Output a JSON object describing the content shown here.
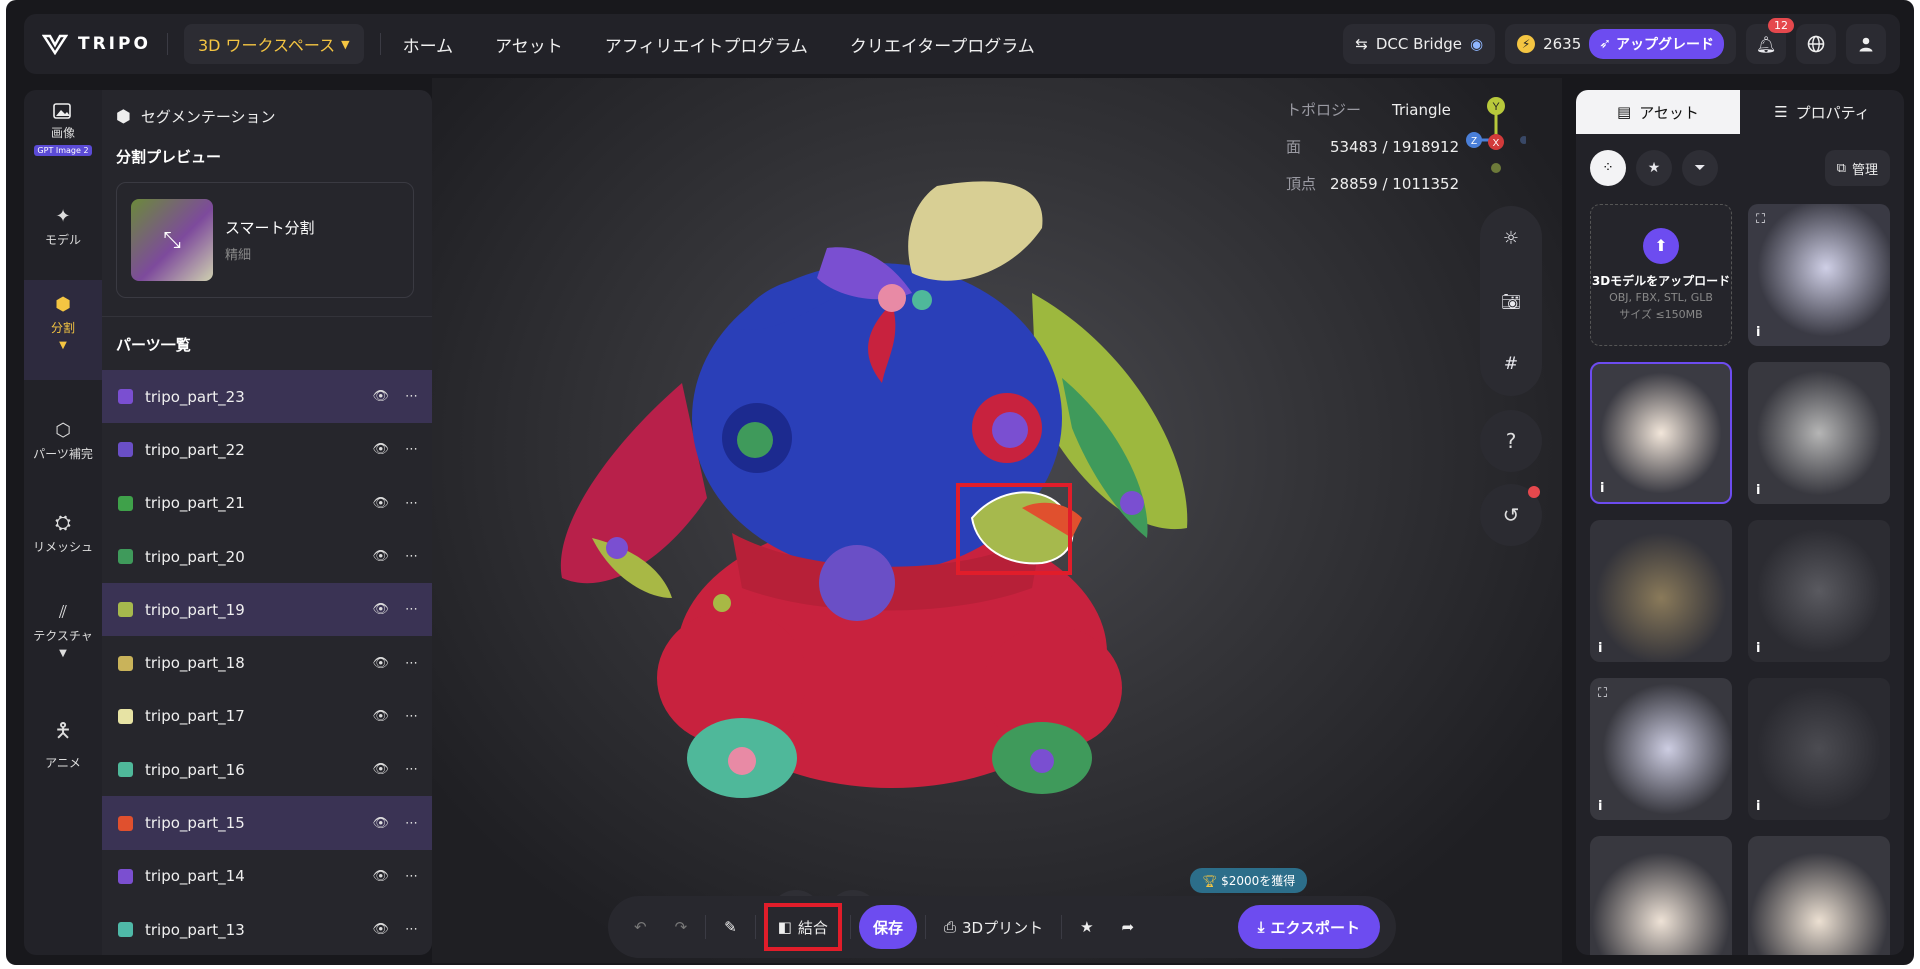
{
  "topbar": {
    "brand": "TRIPO",
    "workspace": "3D ワークスペース",
    "nav": [
      "ホーム",
      "アセット",
      "アフィリエイトプログラム",
      "クリエイタープログラム"
    ],
    "dcc": "DCC Bridge",
    "credits": "2635",
    "upgrade": "アップグレード",
    "notifications": "12"
  },
  "rail": {
    "image": "画像",
    "gpt_tag": "GPT Image 2",
    "model": "モデル",
    "split": "分割",
    "parts_complete": "パーツ補完",
    "remesh": "リメッシュ",
    "texture": "テクスチャ",
    "anime": "アニメ"
  },
  "panel": {
    "header": "セグメンテーション",
    "preview_title": "分割プレビュー",
    "smart_title": "スマート分割",
    "smart_sub": "精細",
    "parts_title": "パーツ一覧",
    "parts": [
      {
        "name": "tripo_part_23",
        "color": "#7a4fd1",
        "highlight": true
      },
      {
        "name": "tripo_part_22",
        "color": "#6a4fc6",
        "highlight": false
      },
      {
        "name": "tripo_part_21",
        "color": "#3fa14a",
        "highlight": false
      },
      {
        "name": "tripo_part_20",
        "color": "#3f9a5b",
        "highlight": false
      },
      {
        "name": "tripo_part_19",
        "color": "#a6b94d",
        "highlight": true
      },
      {
        "name": "tripo_part_18",
        "color": "#c9b35a",
        "highlight": false
      },
      {
        "name": "tripo_part_17",
        "color": "#e7e3a4",
        "highlight": false
      },
      {
        "name": "tripo_part_16",
        "color": "#4fb89a",
        "highlight": false
      },
      {
        "name": "tripo_part_15",
        "color": "#e0502e",
        "highlight": true
      },
      {
        "name": "tripo_part_14",
        "color": "#7b4fd0",
        "highlight": false
      },
      {
        "name": "tripo_part_13",
        "color": "#4fb9a8",
        "highlight": false
      }
    ]
  },
  "viewport": {
    "topology_label": "トポロジー",
    "topology_value": "Triangle",
    "faces_label": "面",
    "faces_value": "53483 / 1918912",
    "verts_label": "頂点",
    "verts_value": "28859 / 1011352",
    "axis_y": "Y",
    "axis_z": "Z",
    "axis_x": "X",
    "help": "?"
  },
  "toolbar": {
    "merge": "結合",
    "save": "保存",
    "print": "3Dプリント",
    "export": "エクスポート",
    "earn": "$2000を獲得"
  },
  "rpanel": {
    "tab_assets": "アセット",
    "tab_props": "プロパティ",
    "manage": "管理",
    "upload_title": "3Dモデルをアップロード",
    "upload_formats": "OBJ, FBX, STL, GLB",
    "upload_size": "サイズ ≤150MB",
    "info": "i"
  },
  "colors": {
    "accent": "#6d4cf0",
    "gold": "#f4c542",
    "highlight_box": "#e11d2a"
  }
}
